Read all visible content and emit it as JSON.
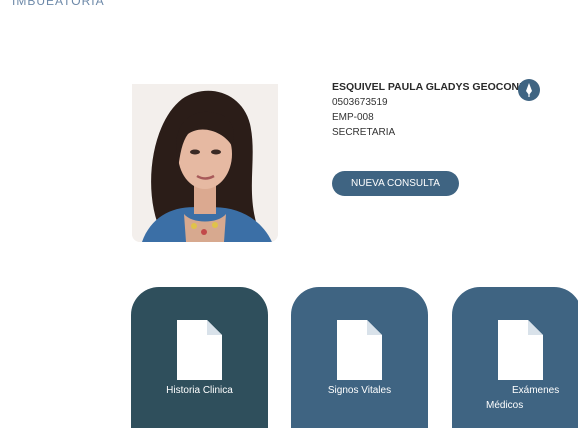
{
  "header": {
    "top_label": "IMBUEATORIA"
  },
  "patient": {
    "name": "ESQUIVEL PAULA GLADYS GEOCONDA",
    "id": "0503673519",
    "code": "EMP-008",
    "role": "SECRETARIA"
  },
  "actions": {
    "nueva_consulta": "NUEVA CONSULTA"
  },
  "tiles": [
    {
      "label": "Historia Clinica",
      "color": "#2f4f5c"
    },
    {
      "label": "Signos Vitales",
      "color": "#3f6482"
    },
    {
      "label_line1": "Exámenes",
      "label_line2": "Médicos",
      "color": "#3f6482"
    }
  ],
  "colors": {
    "accent": "#3f6482",
    "dark_tile": "#2f4f5c"
  },
  "icons": {
    "edit": "pen-icon",
    "document": "document-icon"
  }
}
